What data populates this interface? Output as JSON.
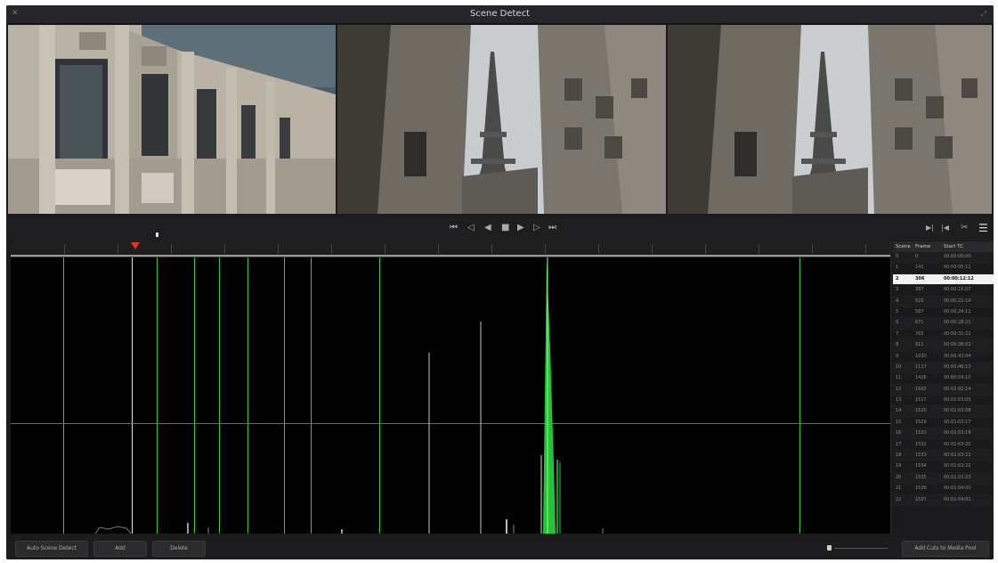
{
  "window": {
    "title": "Scene Detect"
  },
  "transport": {
    "first": "⏮",
    "prev_frame": "◁",
    "play_rev": "◀",
    "stop": "■",
    "play": "▶",
    "next_frame": "▷",
    "last": "⏭",
    "right_a": "▶|",
    "right_b": "|◀",
    "scissors": "✂",
    "list_toggle": "☰"
  },
  "scene_list": {
    "headers": {
      "scene": "Scene",
      "frame": "Frame",
      "start_tc": "Start TC"
    },
    "rows": [
      {
        "scene": "0",
        "frame": "0",
        "tc": "00:00:00:00"
      },
      {
        "scene": "1",
        "frame": "141",
        "tc": "00:00:05:11"
      },
      {
        "scene": "2",
        "frame": "306",
        "tc": "00:00:12:12"
      },
      {
        "scene": "3",
        "frame": "387",
        "tc": "00:00:15:07"
      },
      {
        "scene": "4",
        "frame": "520",
        "tc": "00:00:21:14"
      },
      {
        "scene": "5",
        "frame": "587",
        "tc": "00:00:24:11"
      },
      {
        "scene": "6",
        "frame": "671",
        "tc": "00:00:28:21"
      },
      {
        "scene": "7",
        "frame": "765",
        "tc": "00:00:31:21"
      },
      {
        "scene": "8",
        "frame": "911",
        "tc": "00:00:38:02"
      },
      {
        "scene": "9",
        "frame": "1030",
        "tc": "00:00:43:04"
      },
      {
        "scene": "10",
        "frame": "1117",
        "tc": "00:00:46:13"
      },
      {
        "scene": "11",
        "frame": "1426",
        "tc": "00:00:59:10"
      },
      {
        "scene": "12",
        "frame": "1502",
        "tc": "00:01:02:14"
      },
      {
        "scene": "13",
        "frame": "1517",
        "tc": "00:01:03:05"
      },
      {
        "scene": "14",
        "frame": "1520",
        "tc": "00:01:03:08"
      },
      {
        "scene": "15",
        "frame": "1529",
        "tc": "00:01:03:17"
      },
      {
        "scene": "16",
        "frame": "1531",
        "tc": "00:01:03:19"
      },
      {
        "scene": "17",
        "frame": "1532",
        "tc": "00:01:03:20"
      },
      {
        "scene": "18",
        "frame": "1533",
        "tc": "00:01:03:21"
      },
      {
        "scene": "19",
        "frame": "1534",
        "tc": "00:01:03:22"
      },
      {
        "scene": "20",
        "frame": "1535",
        "tc": "00:01:03:23"
      },
      {
        "scene": "21",
        "frame": "1536",
        "tc": "00:01:04:00"
      },
      {
        "scene": "22",
        "frame": "1537",
        "tc": "00:01:04:01"
      }
    ],
    "selected_index": 2
  },
  "buttons": {
    "auto_scene_detect": "Auto Scene Detect",
    "add": "Add",
    "delete": "Delete",
    "add_cuts": "Add Cuts to Media Pool"
  },
  "colors": {
    "cut_line": "#3cc24a",
    "threshold": "#b23aa1",
    "playhead": "#e0352b"
  }
}
